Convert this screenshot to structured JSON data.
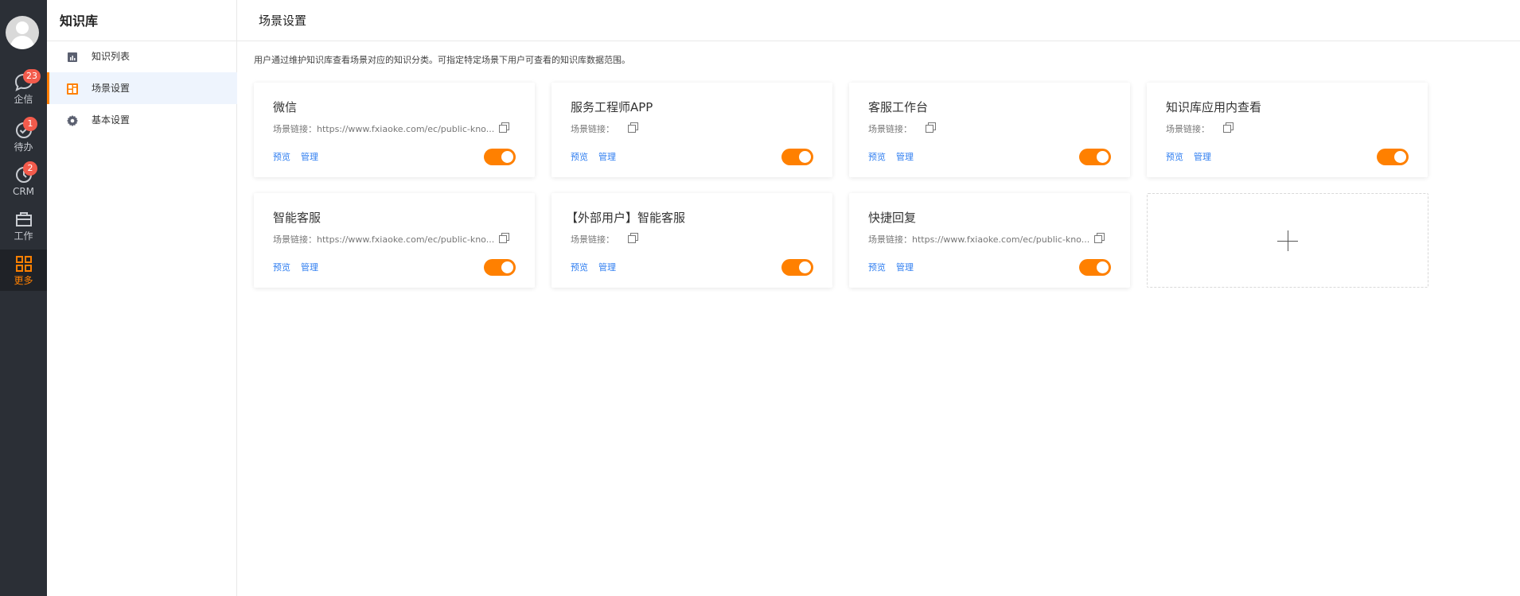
{
  "rail": {
    "items": [
      {
        "label": "企信",
        "badge": "23",
        "icon": "chat-icon"
      },
      {
        "label": "待办",
        "badge": "1",
        "icon": "check-circle-icon"
      },
      {
        "label": "CRM",
        "badge": "2",
        "icon": "clock-icon"
      },
      {
        "label": "工作",
        "icon": "briefcase-icon"
      },
      {
        "label": "更多",
        "icon": "grid-icon",
        "active": true
      }
    ]
  },
  "sidebar": {
    "title": "知识库",
    "items": [
      {
        "label": "知识列表",
        "icon": "bar-chart-icon"
      },
      {
        "label": "场景设置",
        "icon": "layout-icon",
        "active": true
      },
      {
        "label": "基本设置",
        "icon": "gear-icon"
      }
    ]
  },
  "main": {
    "title": "场景设置",
    "description": "用户通过维护知识库查看场景对应的知识分类。可指定特定场景下用户可查看的知识库数据范围。",
    "preview_label": "预览",
    "manage_label": "管理",
    "cards": [
      {
        "title": "微信",
        "link_text": "场景链接：https://www.fxiaoke.com/ec/public-kno...",
        "enabled": true
      },
      {
        "title": "服务工程师APP",
        "link_text": "场景链接：",
        "enabled": true
      },
      {
        "title": "客服工作台",
        "link_text": "场景链接：",
        "enabled": true
      },
      {
        "title": "知识库应用内查看",
        "link_text": "场景链接：",
        "enabled": true
      },
      {
        "title": "智能客服",
        "link_text": "场景链接：https://www.fxiaoke.com/ec/public-kno...",
        "enabled": true
      },
      {
        "title": "【外部用户】智能客服",
        "link_text": "场景链接：",
        "enabled": true
      },
      {
        "title": "快捷回复",
        "link_text": "场景链接：https://www.fxiaoke.com/ec/public-kno...",
        "enabled": true
      }
    ]
  },
  "colors": {
    "accent": "#ff8000",
    "link": "#2f7ef0",
    "rail_bg": "#2b2f36",
    "badge": "#f35b4c"
  }
}
